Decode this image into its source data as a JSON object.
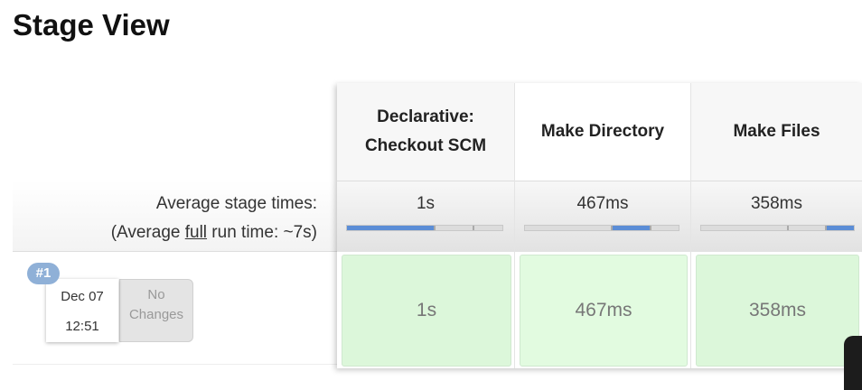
{
  "title": "Stage View",
  "summary": {
    "avg_stage_times_label": "Average stage times:",
    "avg_run_prefix": "(Average ",
    "avg_run_full": "full",
    "avg_run_suffix": " run time: ~7s)"
  },
  "build": {
    "number": "#1",
    "date": "Dec 07",
    "time": "12:51",
    "changes_line1": "No",
    "changes_line2": "Changes"
  },
  "stages": [
    {
      "name_line1": "Declarative:",
      "name_line2": "Checkout SCM",
      "avg_time": "1s",
      "progress_start": 0.0,
      "progress_end": 0.56,
      "build_time": "1s",
      "cell_color": "#dcf7da"
    },
    {
      "name_line1": "Make Directory",
      "name_line2": "",
      "avg_time": "467ms",
      "progress_start": 0.56,
      "progress_end": 0.81,
      "build_time": "467ms",
      "cell_color": "#e2fbe0"
    },
    {
      "name_line1": "Make Files",
      "name_line2": "",
      "avg_time": "358ms",
      "progress_start": 0.81,
      "progress_end": 1.0,
      "build_time": "358ms",
      "cell_color": "#dcf7da"
    }
  ],
  "colors": {
    "badge": "#8fb0d7",
    "progress_fill": "#5b8dd6",
    "success_cell": "#dcf7da"
  }
}
